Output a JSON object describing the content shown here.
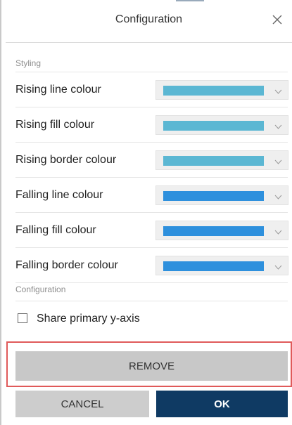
{
  "dialog": {
    "title": "Configuration"
  },
  "styling": {
    "section_title": "Styling",
    "rows": [
      {
        "label": "Rising line colour",
        "color": "#5bb7d3"
      },
      {
        "label": "Rising fill colour",
        "color": "#5bb7d3"
      },
      {
        "label": "Rising border colour",
        "color": "#5bb7d3"
      },
      {
        "label": "Falling line colour",
        "color": "#2e90dd"
      },
      {
        "label": "Falling fill colour",
        "color": "#2e90dd"
      },
      {
        "label": "Falling border colour",
        "color": "#2e90dd"
      }
    ]
  },
  "configuration": {
    "section_title": "Configuration",
    "share_axis_label": "Share primary y-axis",
    "share_axis_checked": false
  },
  "buttons": {
    "remove": "REMOVE",
    "cancel": "CANCEL",
    "ok": "OK"
  },
  "colors": {
    "highlight": "#e05a5a",
    "ok_bg": "#0f3a63",
    "button_gray": "#c8c8c8"
  },
  "icons": {
    "close": "close-icon",
    "dropdown": "chevron-down-icon"
  }
}
